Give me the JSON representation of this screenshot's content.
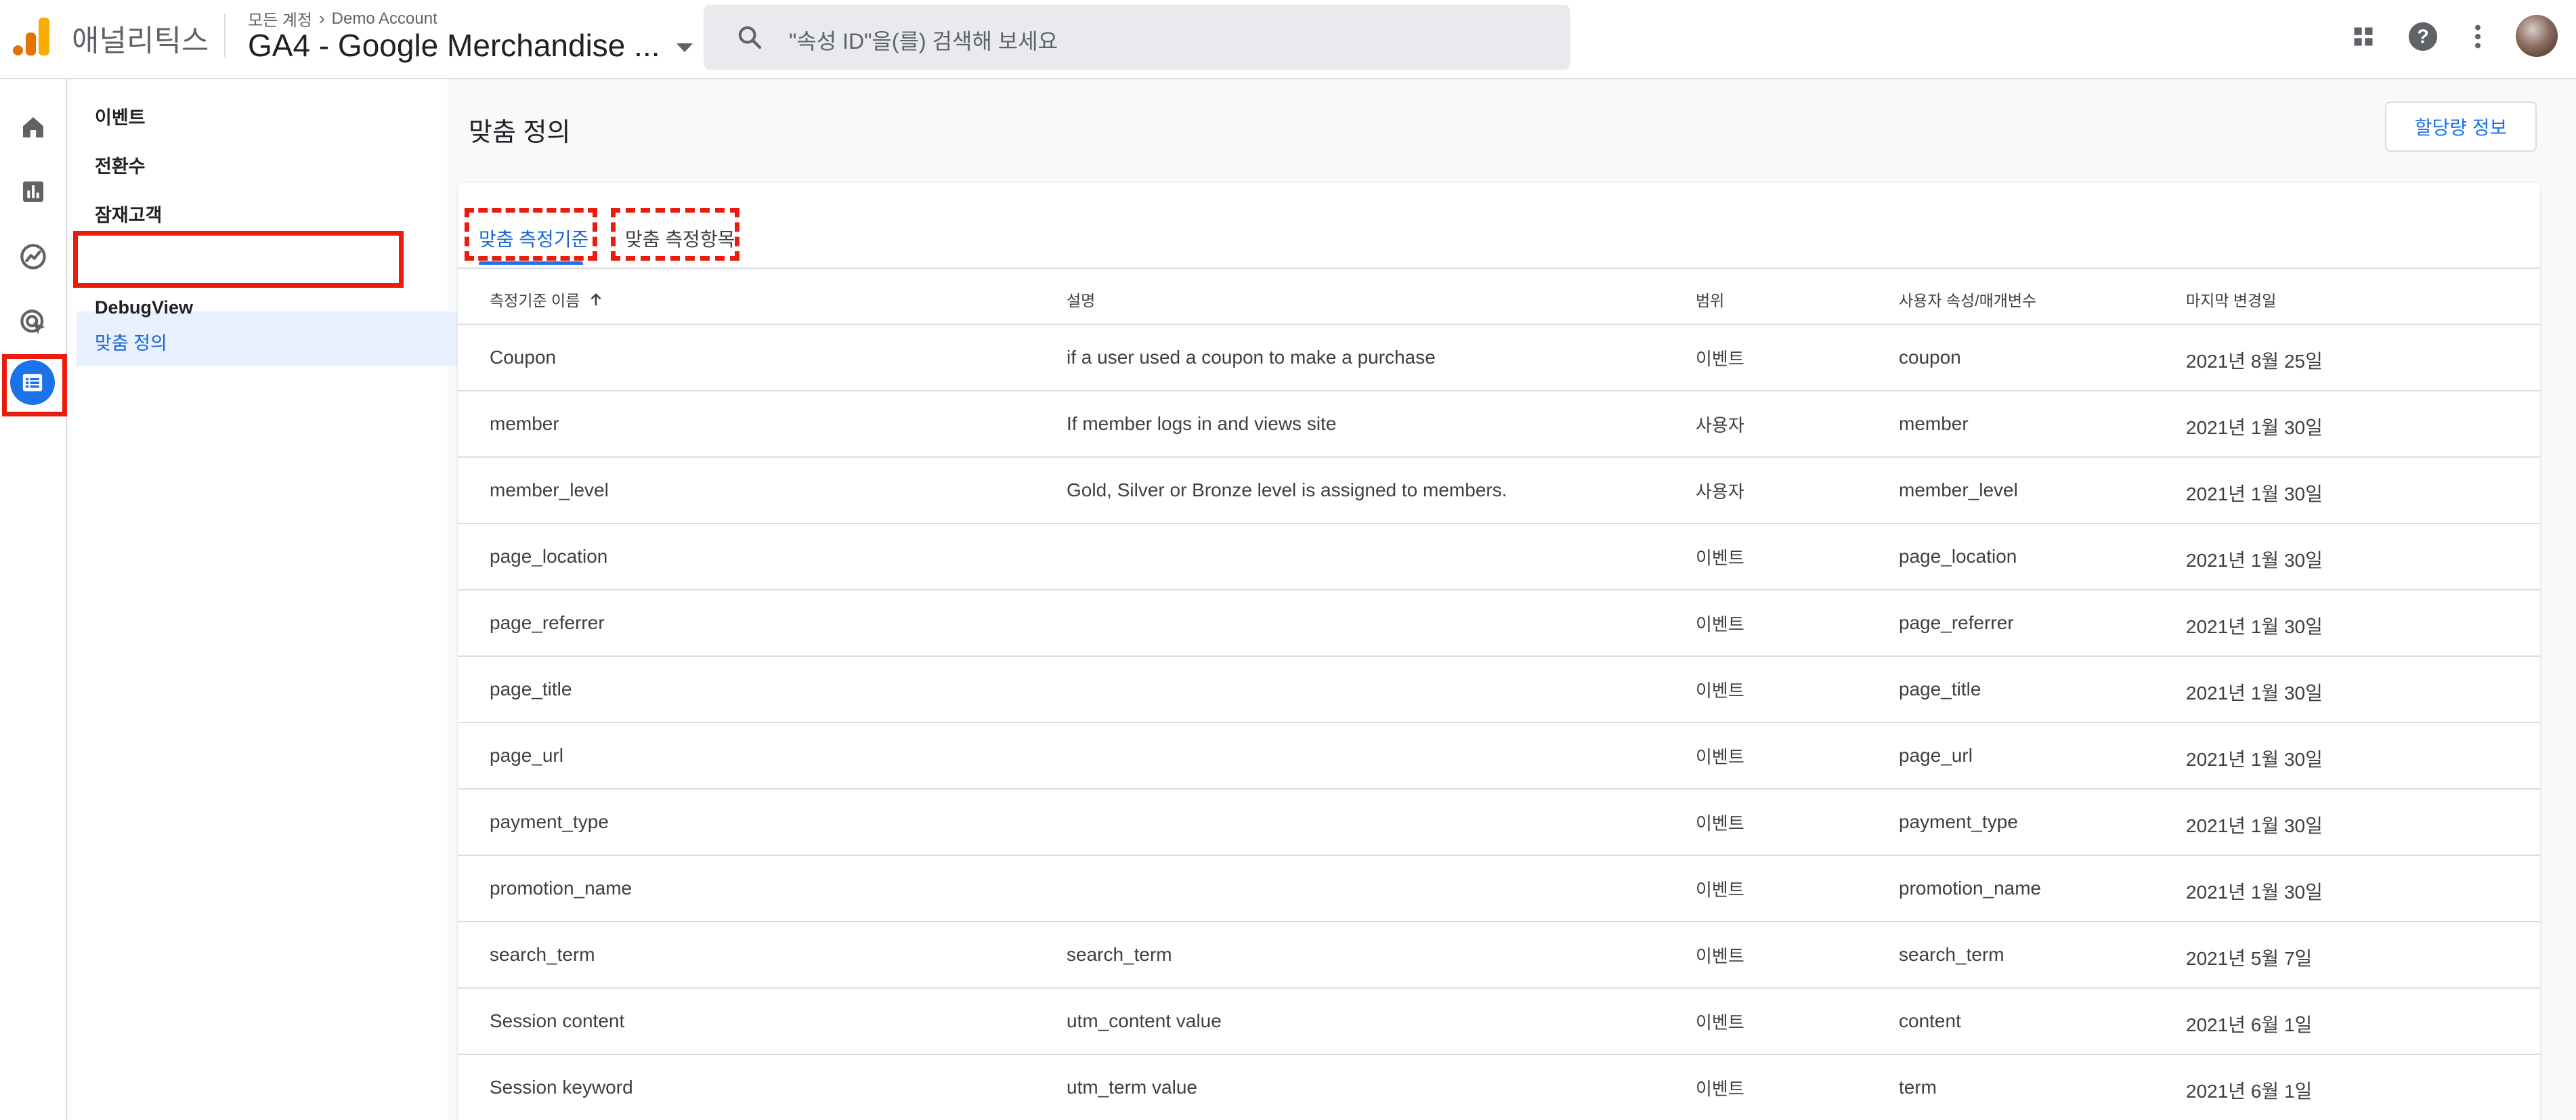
{
  "header": {
    "app_name": "애널리틱스",
    "breadcrumb_parent": "모든 계정",
    "breadcrumb_child": "Demo Account",
    "property_name": "GA4 - Google Merchandise ...",
    "search_placeholder": "\"속성 ID\"을(를) 검색해 보세요",
    "icons": [
      "apps-grid-icon",
      "help-icon",
      "more-vert-icon",
      "avatar"
    ],
    "logo_colors": [
      "#f9ab00",
      "#e37400",
      "#e37400"
    ]
  },
  "rail": {
    "items": [
      "home-icon",
      "reports-icon",
      "explore-icon",
      "advertising-icon",
      "configure-icon"
    ],
    "active_index": 4
  },
  "subnav": {
    "items": [
      {
        "label": "이벤트"
      },
      {
        "label": "전환수"
      },
      {
        "label": "잠재고객"
      },
      {
        "label": "맞춤 정의"
      },
      {
        "label": "DebugView"
      }
    ],
    "active_index": 3
  },
  "main": {
    "page_title": "맞춤 정의",
    "quota_button": "할당량 정보",
    "tabs": [
      {
        "label": "맞춤 측정기준",
        "active": true
      },
      {
        "label": "맞춤 측정항목",
        "active": false
      }
    ],
    "columns": [
      "측정기준 이름",
      "설명",
      "범위",
      "사용자 속성/매개변수",
      "마지막 변경일"
    ],
    "sort_indicator": "arrow-upward-icon",
    "rows": [
      {
        "name": "Coupon",
        "description": "if a user used a coupon to make a purchase",
        "scope": "이벤트",
        "parameter": "coupon",
        "modified": "2021년 8월 25일"
      },
      {
        "name": "member",
        "description": "If member logs in and views site",
        "scope": "사용자",
        "parameter": "member",
        "modified": "2021년 1월 30일"
      },
      {
        "name": "member_level",
        "description": "Gold, Silver or Bronze level is assigned to members.",
        "scope": "사용자",
        "parameter": "member_level",
        "modified": "2021년 1월 30일"
      },
      {
        "name": "page_location",
        "description": "",
        "scope": "이벤트",
        "parameter": "page_location",
        "modified": "2021년 1월 30일"
      },
      {
        "name": "page_referrer",
        "description": "",
        "scope": "이벤트",
        "parameter": "page_referrer",
        "modified": "2021년 1월 30일"
      },
      {
        "name": "page_title",
        "description": "",
        "scope": "이벤트",
        "parameter": "page_title",
        "modified": "2021년 1월 30일"
      },
      {
        "name": "page_url",
        "description": "",
        "scope": "이벤트",
        "parameter": "page_url",
        "modified": "2021년 1월 30일"
      },
      {
        "name": "payment_type",
        "description": "",
        "scope": "이벤트",
        "parameter": "payment_type",
        "modified": "2021년 1월 30일"
      },
      {
        "name": "promotion_name",
        "description": "",
        "scope": "이벤트",
        "parameter": "promotion_name",
        "modified": "2021년 1월 30일"
      },
      {
        "name": "search_term",
        "description": "search_term",
        "scope": "이벤트",
        "parameter": "search_term",
        "modified": "2021년 5월 7일"
      },
      {
        "name": "Session content",
        "description": "utm_content value",
        "scope": "이벤트",
        "parameter": "content",
        "modified": "2021년 6월 1일"
      },
      {
        "name": "Session keyword",
        "description": "utm_term value",
        "scope": "이벤트",
        "parameter": "term",
        "modified": "2021년 6월 1일"
      }
    ]
  },
  "colors": {
    "accent": "#1a73e8",
    "annotation_red": "#ea1c0d",
    "active_bg": "#e8f0fe"
  }
}
